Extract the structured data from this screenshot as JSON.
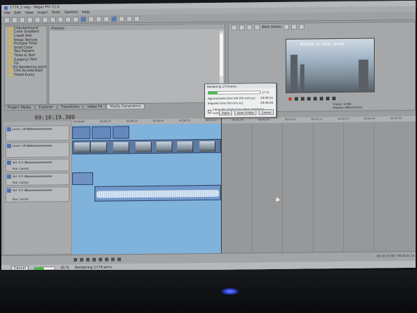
{
  "window": {
    "title": "1779_1.veg - Vegas Pro 12.0"
  },
  "menu": [
    "File",
    "Edit",
    "View",
    "Insert",
    "Tools",
    "Options",
    "Help"
  ],
  "explorer": {
    "items": [
      "Checkerboard",
      "Color Gradient",
      "Credit Roll",
      "Noise Texture",
      "ProType Titler",
      "Solid Color",
      "Test Pattern",
      "Titles & Text",
      "(Legacy) Text",
      "Cp",
      "DV Rendering paint",
      "CPU Accelerated",
      "Titled Every"
    ]
  },
  "presets": {
    "header": "Presets:"
  },
  "tabs": [
    "Project Media",
    "Explorer",
    "Transitions",
    "Video FX",
    "Media Generators"
  ],
  "preview": {
    "label": "Best (Auto)",
    "overlay_text": "Battle is Hee, brah",
    "info": [
      "Frame: 1,482",
      "Display: 480x270x32"
    ]
  },
  "dialog": {
    "title": "Rendering 1779.wmv",
    "progress": 0.17,
    "percent": "17 %",
    "rows": [
      {
        "label": "Approximate time left (hh:mm:ss):",
        "value": "00:00:31"
      },
      {
        "label": "Elapsed time (hh:mm:ss):",
        "value": "00:00:06"
      }
    ],
    "checkbox": "Close this dialog box when rendering completes",
    "buttons": [
      "Open",
      "Open Folder",
      "Cancel"
    ]
  },
  "timeline": {
    "time": "00:10:19.300",
    "ruler": [
      "00:00:00",
      "00:00:15",
      "00:00:29",
      "00:00:44",
      "00:00:59",
      "00:01:14",
      "00:01:29",
      "00:01:44",
      "00:01:59",
      "00:02:14",
      "00:02:29",
      "00:02:44",
      "00:02:59"
    ],
    "tracks": [
      {
        "num": "1",
        "label": "Level: 100.0 %",
        "label2": ""
      },
      {
        "num": "2",
        "label": "Level: 100.0 %",
        "label2": ""
      },
      {
        "num": "3",
        "label": "Vol: 0.0 dB",
        "label2": "Pan: Center"
      },
      {
        "num": "4",
        "label": "Vol: 0.0 dB",
        "label2": "Pan: Center"
      },
      {
        "num": "5",
        "label": "Vol: 0.0 dB",
        "label2": "Pan: Center"
      }
    ]
  },
  "footer": {
    "time_left": "00:10:19.300",
    "time_right": "00:01:21:14"
  },
  "statusbar": {
    "cancel": "Cancel",
    "progress": 0.45,
    "pct": "45 %",
    "status": "Rendering 1779.wmv"
  }
}
